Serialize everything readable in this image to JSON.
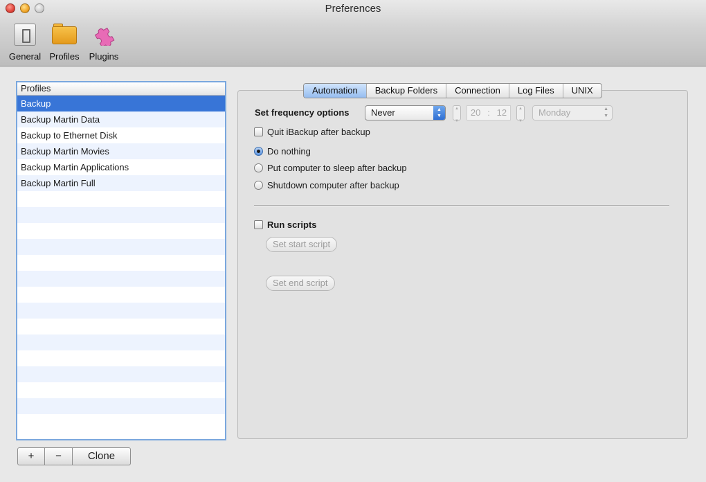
{
  "window": {
    "title": "Preferences"
  },
  "toolbar": {
    "items": [
      {
        "label": "General",
        "icon": "general-switch-icon"
      },
      {
        "label": "Profiles",
        "icon": "folder-icon"
      },
      {
        "label": "Plugins",
        "icon": "puzzle-icon"
      }
    ]
  },
  "profiles": {
    "header": "Profiles",
    "items": [
      "Backup",
      "Backup Martin Data",
      "Backup to Ethernet Disk",
      "Backup Martin Movies",
      "Backup Martin Applications",
      "Backup Martin Full"
    ],
    "selected_index": 0,
    "add_label": "+",
    "remove_label": "−",
    "clone_label": "Clone"
  },
  "tabs": {
    "items": [
      "Automation",
      "Backup Folders",
      "Connection",
      "Log Files",
      "UNIX"
    ],
    "active_index": 0
  },
  "automation": {
    "frequency_label": "Set frequency options",
    "frequency_value": "Never",
    "hour": "20",
    "minute": "12",
    "day_value": "Monday",
    "quit_label": "Quit iBackup after backup",
    "quit_checked": false,
    "radio_do_nothing": "Do nothing",
    "radio_sleep": "Put computer to sleep after backup",
    "radio_shutdown": "Shutdown computer after backup",
    "selected_radio": "Do nothing",
    "run_scripts_label": "Run scripts",
    "run_scripts_checked": false,
    "start_script_label": "Set start script",
    "end_script_label": "Set end script"
  },
  "colors": {
    "selection": "#3875d7",
    "alt_row": "#edf3fe",
    "active_tab": "#96bdf0"
  }
}
